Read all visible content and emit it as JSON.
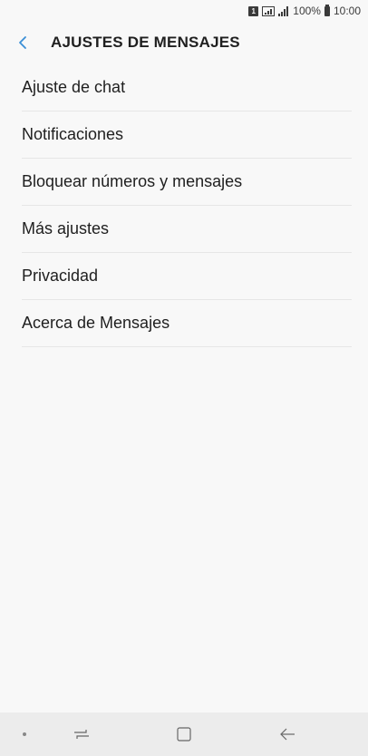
{
  "status_bar": {
    "sim_label": "1",
    "battery_percent": "100%",
    "time": "10:00"
  },
  "header": {
    "title": "AJUSTES DE MENSAJES",
    "back_icon": "chevron-left-icon"
  },
  "settings": {
    "items": [
      {
        "label": "Ajuste de chat"
      },
      {
        "label": "Notificaciones"
      },
      {
        "label": "Bloquear números y mensajes"
      },
      {
        "label": "Más ajustes"
      },
      {
        "label": "Privacidad"
      },
      {
        "label": "Acerca de Mensajes"
      }
    ]
  },
  "nav_bar": {
    "buttons": [
      "recent-apps-icon",
      "home-icon",
      "back-arrow-icon"
    ]
  },
  "colors": {
    "accent": "#3a8fd6",
    "background": "#f8f8f8",
    "nav_background": "#ececec"
  }
}
